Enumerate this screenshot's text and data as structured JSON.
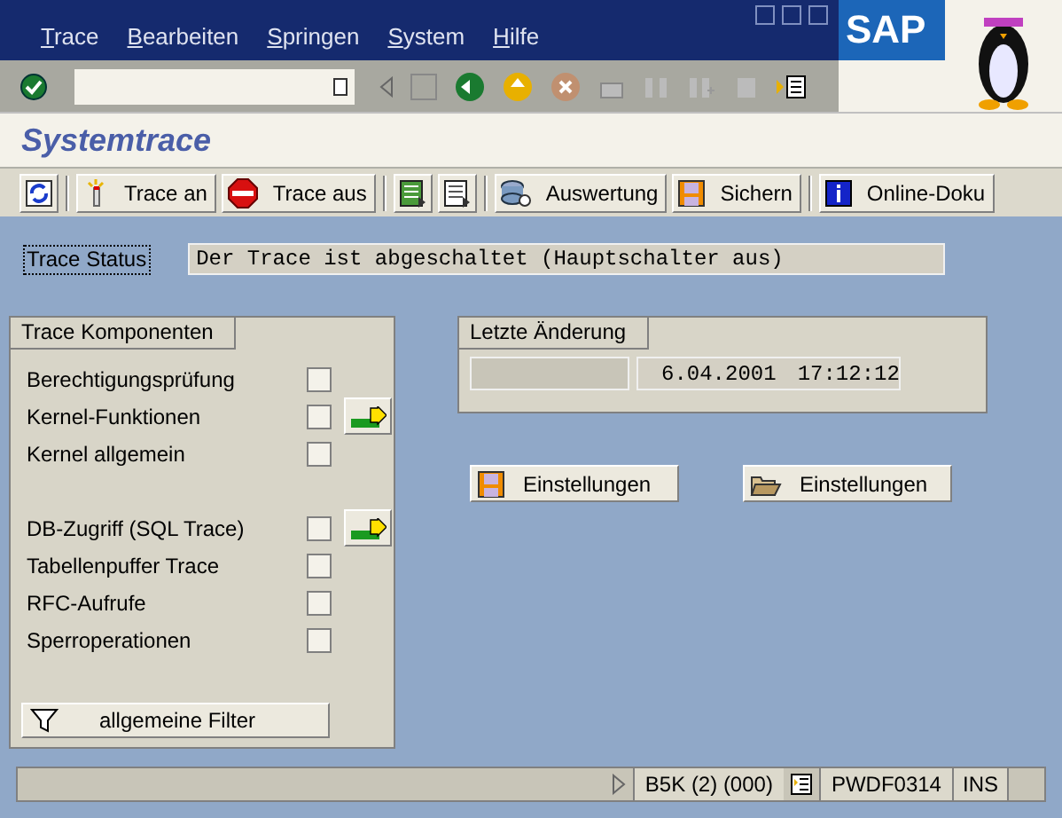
{
  "menu": [
    "Trace",
    "Bearbeiten",
    "Springen",
    "System",
    "Hilfe"
  ],
  "logo": "SAP",
  "title": "Systemtrace",
  "app_toolbar": [
    {
      "kind": "refresh"
    },
    {
      "kind": "wand",
      "label": "Trace an"
    },
    {
      "kind": "stop",
      "label": "Trace aus"
    },
    {
      "kind": "list"
    },
    {
      "kind": "doc"
    },
    {
      "kind": "analysis",
      "label": "Auswertung"
    },
    {
      "kind": "save",
      "label": "Sichern"
    },
    {
      "kind": "info",
      "label": "Online-Doku"
    }
  ],
  "trace_status": {
    "label": "Trace Status",
    "value": "Der Trace ist abgeschaltet (Hauptschalter aus)"
  },
  "components": {
    "title": "Trace Komponenten",
    "items": [
      {
        "label": "Berechtigungsprüfung",
        "checked": false,
        "detail_button": false
      },
      {
        "label": "Kernel-Funktionen",
        "checked": false,
        "detail_button": true
      },
      {
        "label": "Kernel allgemein",
        "checked": false,
        "detail_button": false
      },
      {
        "label": "DB-Zugriff (SQL Trace)",
        "checked": false,
        "detail_button": true
      },
      {
        "label": "Tabellenpuffer Trace",
        "checked": false,
        "detail_button": false
      },
      {
        "label": "RFC-Aufrufe",
        "checked": false,
        "detail_button": false
      },
      {
        "label": "Sperroperationen",
        "checked": false,
        "detail_button": false
      }
    ],
    "filter_button": "allgemeine Filter"
  },
  "last_change": {
    "title": "Letzte Änderung",
    "date": "6.04.2001",
    "time": "17:12:12"
  },
  "settings_buttons": [
    {
      "kind": "save",
      "label": "Einstellungen"
    },
    {
      "kind": "open",
      "label": "Einstellungen"
    }
  ],
  "status_bar": {
    "system": "B5K (2) (000)",
    "server": "PWDF0314",
    "mode": "INS"
  }
}
